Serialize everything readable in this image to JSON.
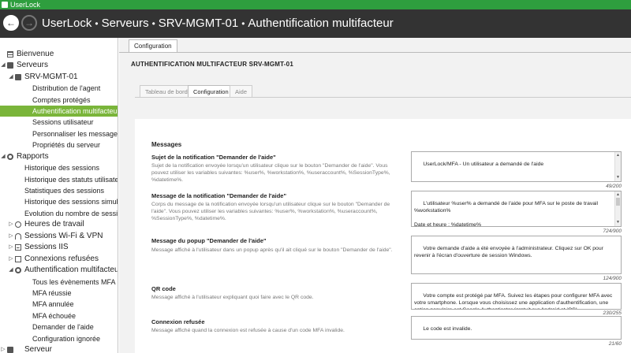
{
  "window": {
    "title": "UserLock"
  },
  "header": {
    "breadcrumb": [
      "UserLock",
      "Serveurs",
      "SRV-MGMT-01",
      "Authentification multifacteur"
    ]
  },
  "sidebar": {
    "items": [
      {
        "label": "Bienvenue",
        "icon": "home-icon"
      },
      {
        "label": "Serveurs",
        "icon": "server-icon",
        "expanded": true
      },
      {
        "label": "SRV-MGMT-01",
        "icon": "server-icon",
        "expanded": true
      },
      {
        "label": "Distribution de l'agent"
      },
      {
        "label": "Comptes protégés"
      },
      {
        "label": "Authentification multifacteur",
        "active": true
      },
      {
        "label": "Sessions utilisateur"
      },
      {
        "label": "Personnaliser les messages"
      },
      {
        "label": "Propriétés du serveur"
      },
      {
        "label": "Rapports",
        "icon": "gear-icon",
        "expanded": true
      },
      {
        "label": "Historique des sessions"
      },
      {
        "label": "Historique des statuts utilisateur"
      },
      {
        "label": "Statistiques des sessions"
      },
      {
        "label": "Historique des sessions simultanées"
      },
      {
        "label": "Evolution du nombre de sessions"
      },
      {
        "label": "Heures de travail",
        "icon": "clock-icon"
      },
      {
        "label": "Sessions Wi-Fi & VPN",
        "icon": "wifi-icon"
      },
      {
        "label": "Sessions IIS",
        "icon": "sessions-icon"
      },
      {
        "label": "Connexions refusées",
        "icon": "denied-icon"
      },
      {
        "label": "Authentification multifacteur",
        "icon": "key-icon",
        "expanded": true
      },
      {
        "label": "Tous les évènements MFA"
      },
      {
        "label": "MFA réussie"
      },
      {
        "label": "MFA annulée"
      },
      {
        "label": "MFA échouée"
      },
      {
        "label": "Demander de l'aide"
      },
      {
        "label": "Configuration ignorée"
      },
      {
        "label": "Serveur",
        "icon": "server-icon"
      }
    ]
  },
  "main": {
    "top_tab": "Configuration",
    "heading": "AUTHENTIFICATION MULTIFACTEUR  SRV-MGMT-01",
    "tabs": [
      {
        "label": "Tableau de bord",
        "active": false
      },
      {
        "label": "Configuration",
        "active": true
      },
      {
        "label": "Aide",
        "active": false
      }
    ],
    "section_title": "Messages",
    "fields": [
      {
        "label": "Sujet de la notification \"Demander de l'aide\"",
        "description": "Sujet de la notification envoyée lorsqu'un utilisateur clique sur le bouton \"Demander de l'aide\". Vous pouvez utiliser les variables suivantes: %user%, %workstation%, %useraccount%, %SessionType%, %datetime%.",
        "value": "UserLock/MFA - Un utilisateur a demandé de l'aide",
        "counter": "49/200"
      },
      {
        "label": "Message de la notification \"Demander de l'aide\"",
        "description": "Corps du message de la notification envoyée lorsqu'un utilisateur clique sur le bouton \"Demander de l'aide\". Vous pouvez utiliser les variables suivantes: %user%, %workstation%, %useraccount%, %SessionType%, %datetime%.",
        "value": "L'utilisateur %user% a demandé de l'aide pour MFA sur le poste de travail %workstation%\n\nDate et heure : %datetime%\n- Compte utilisateur : %useraccount%",
        "counter": "724/900"
      },
      {
        "label": "Message du popup \"Demander de l'aide\"",
        "description": "Message affiché à l'utilisateur dans un popup après qu'il ait cliqué sur le bouton \"Demander de l'aide\".",
        "value": "Votre demande d'aide a été envoyée à l'administrateur. Cliquez sur OK pour revenir à l'écran d'ouverture de session Windows.",
        "counter": "124/900"
      },
      {
        "label": "QR code",
        "description": "Message affiché à l'utilisateur expliquant quoi faire avec le QR code.",
        "value": "Votre compte est protégé par MFA. Suivez les étapes pour configurer MFA avec votre smartphone. Lorsque vous choisissez une application d'authentification, une option populaire est Google Authenticator (gratuit sur Android et iOS).",
        "counter": "230/255"
      },
      {
        "label": "Connexion refusée",
        "description": "Message affiché quand la connexion est refusée à cause d'un code MFA invalide.",
        "value": "Le code est invalide.",
        "counter": "21/60"
      }
    ]
  },
  "colors": {
    "titlebar": "#2e9e3e",
    "header": "#333333",
    "active_item": "#7ab53a"
  }
}
